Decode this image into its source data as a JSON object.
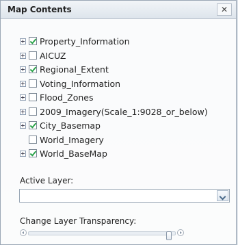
{
  "panel": {
    "title": "Map Contents",
    "close_label": "✕"
  },
  "layers": [
    {
      "name": "Property_Information",
      "checked": true,
      "expandable": true
    },
    {
      "name": "AICUZ",
      "checked": false,
      "expandable": true
    },
    {
      "name": "Regional_Extent",
      "checked": true,
      "expandable": true
    },
    {
      "name": "Voting_Information",
      "checked": false,
      "expandable": true
    },
    {
      "name": "Flood_Zones",
      "checked": false,
      "expandable": true
    },
    {
      "name": "2009_Imagery(Scale_1:9028_or_below)",
      "checked": false,
      "expandable": true
    },
    {
      "name": "City_Basemap",
      "checked": true,
      "expandable": true
    },
    {
      "name": "World_Imagery",
      "checked": false,
      "expandable": false
    },
    {
      "name": "World_BaseMap",
      "checked": true,
      "expandable": true
    }
  ],
  "active_layer": {
    "label": "Active Layer:",
    "value": ""
  },
  "transparency": {
    "label": "Change Layer Transparency:",
    "level": 0.95
  },
  "colors": {
    "checkmark": "#2aa24a",
    "panel_border": "#9aa6b4"
  }
}
